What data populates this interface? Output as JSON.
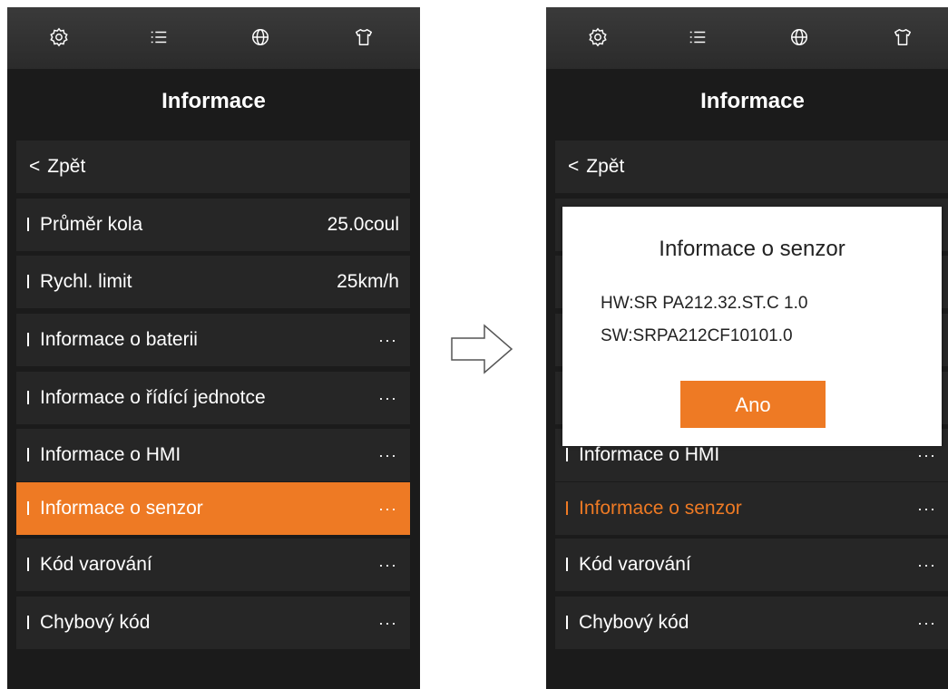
{
  "colors": {
    "accent": "#ee7a24",
    "background": "#1b1b1b",
    "row": "#262626",
    "topbar": "#333333"
  },
  "topbar_icons": [
    "settings-icon",
    "list-icon",
    "globe-icon",
    "shirt-icon"
  ],
  "left": {
    "title": "Informace",
    "back_label": "Zpět",
    "items": [
      {
        "label": "Průměr kola",
        "value": "25.0coul"
      },
      {
        "label": "Rychl. limit",
        "value": "25km/h"
      },
      {
        "label": "Informace o baterii",
        "value": "···"
      },
      {
        "label": "Informace o řídící jednotce",
        "value": "···"
      },
      {
        "label": "Informace o HMI",
        "value": "···"
      },
      {
        "label": "Informace o senzor",
        "value": "···",
        "selected": true
      },
      {
        "label": "Kód varování",
        "value": "···"
      },
      {
        "label": "Chybový kód",
        "value": "···"
      }
    ]
  },
  "right": {
    "title": "Informace",
    "back_label": "Zpět",
    "visible_items": [
      {
        "label": "Informace o HMI",
        "value": "···"
      },
      {
        "label": "Informace o senzor",
        "value": "···"
      },
      {
        "label": "Kód varování",
        "value": "···"
      },
      {
        "label": "Chybový kód",
        "value": "···"
      }
    ],
    "dialog": {
      "title": "Informace o senzor",
      "hw": "HW:SR PA212.32.ST.C 1.0",
      "sw": "SW:SRPA212CF10101.0",
      "ok_label": "Ano"
    }
  }
}
